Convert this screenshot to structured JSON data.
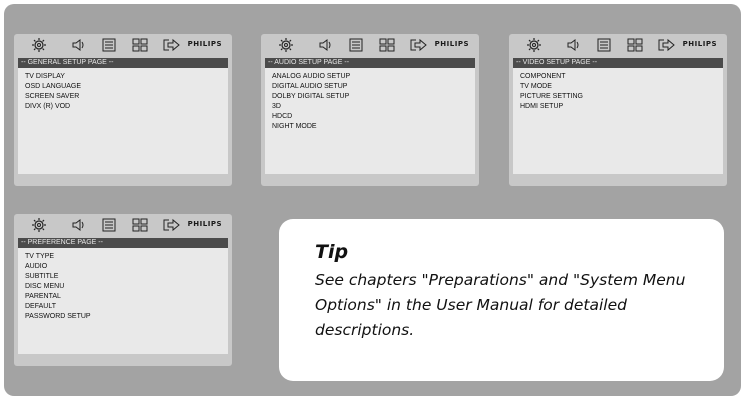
{
  "brand": "PHILIPS",
  "icons": [
    "settings-icon",
    "audio-icon",
    "video-icon",
    "preference-icon",
    "exit-icon"
  ],
  "panels": {
    "general": {
      "title": "-- GENERAL SETUP PAGE --",
      "items": [
        "TV DISPLAY",
        "OSD LANGUAGE",
        "SCREEN SAVER",
        "DIVX (R) VOD"
      ]
    },
    "audio": {
      "title": "-- AUDIO SETUP PAGE --",
      "items": [
        "ANALOG AUDIO SETUP",
        "DIGITAL AUDIO SETUP",
        "DOLBY DIGITAL SETUP",
        "3D",
        "HDCD",
        "NIGHT MODE"
      ]
    },
    "video": {
      "title": "-- VIDEO SETUP PAGE --",
      "items": [
        "COMPONENT",
        "TV MODE",
        "PICTURE SETTING",
        "HDMI SETUP"
      ]
    },
    "preference": {
      "title": "-- PREFERENCE PAGE --",
      "items": [
        "TV TYPE",
        "AUDIO",
        "SUBTITLE",
        "DISC MENU",
        "PARENTAL",
        "DEFAULT",
        "PASSWORD SETUP"
      ]
    }
  },
  "tip": {
    "title": "Tip",
    "body": "See chapters \"Preparations\" and \"System Menu Options\" in the User Manual for detailed descriptions."
  },
  "colors": {
    "frame": "#a3a3a3",
    "panel": "#c8c8c8",
    "title_bar": "#4b4b4b",
    "menu_bg": "#e9e9e9",
    "tip_bg": "#ffffff"
  }
}
